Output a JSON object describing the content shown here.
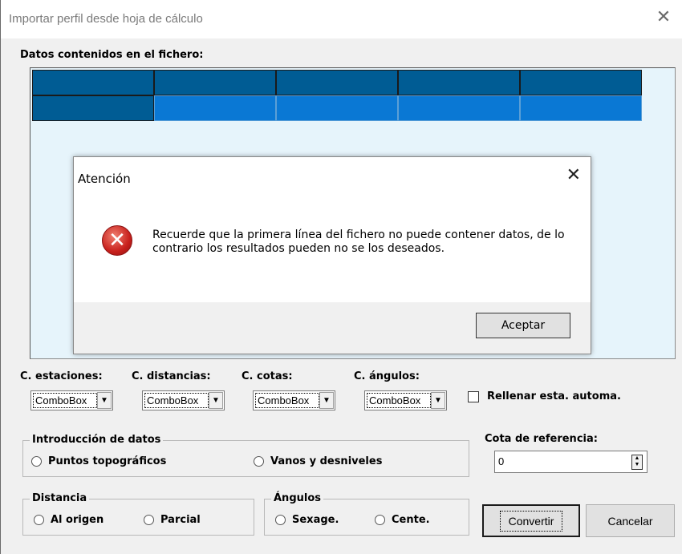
{
  "window": {
    "title": "Importar perfil desde hoja de cálculo",
    "close_glyph": "✕"
  },
  "grid": {
    "label": "Datos contenidos en el fichero:"
  },
  "columns": {
    "estaciones": {
      "label": "C. estaciones:",
      "value": "ComboBox"
    },
    "distancias": {
      "label": "C. distancias:",
      "value": "ComboBox"
    },
    "cotas": {
      "label": "C. cotas:",
      "value": "ComboBox"
    },
    "angulos": {
      "label": "C. ángulos:",
      "value": "ComboBox"
    },
    "arrow": "▼"
  },
  "autofill": {
    "label": "Rellenar esta. automa."
  },
  "entry": {
    "title": "Introducción de datos",
    "option1": "Puntos topográficos",
    "option2": "Vanos y desniveles"
  },
  "reference": {
    "label": "Cota de referencia:",
    "value": "0"
  },
  "distance": {
    "title": "Distancia",
    "option1": "Al origen",
    "option2": "Parcial"
  },
  "angles": {
    "title": "Ángulos",
    "option1": "Sexage.",
    "option2": "Cente."
  },
  "buttons": {
    "convert": "Convertir",
    "cancel": "Cancelar"
  },
  "dialog": {
    "title": "Atención",
    "close_glyph": "✕",
    "icon": "error-icon",
    "message": "Recuerde que la primera línea del fichero no puede contener datos, de lo contrario los resultados pueden no se los deseados.",
    "ok": "Aceptar"
  }
}
